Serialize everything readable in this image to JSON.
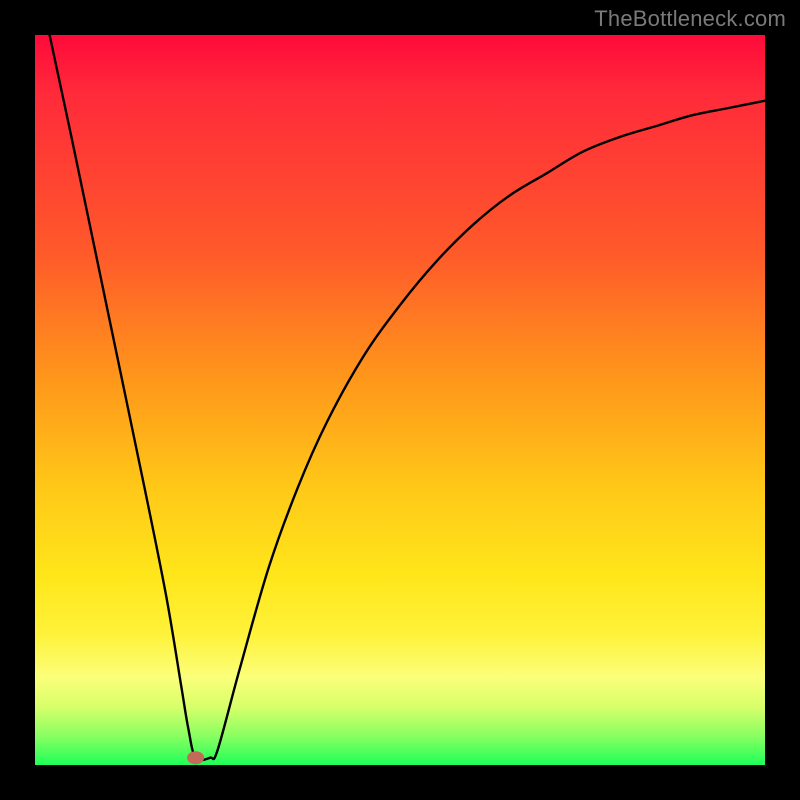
{
  "watermark": "TheBottleneck.com",
  "colors": {
    "gradient_top": "#ff0a3a",
    "gradient_mid1": "#ff9a1a",
    "gradient_mid2": "#ffe61a",
    "gradient_bottom": "#1eff58",
    "curve": "#000000",
    "dot": "#c46a5a",
    "frame": "#000000"
  },
  "chart_data": {
    "type": "line",
    "title": "",
    "xlabel": "",
    "ylabel": "",
    "xlim": [
      0,
      100
    ],
    "ylim": [
      0,
      100
    ],
    "series": [
      {
        "name": "bottleneck-curve",
        "x": [
          2,
          5,
          10,
          15,
          18,
          20,
          21,
          22,
          24,
          25,
          28,
          32,
          36,
          40,
          45,
          50,
          55,
          60,
          65,
          70,
          75,
          80,
          85,
          90,
          95,
          100
        ],
        "values": [
          100,
          86,
          62,
          38,
          23,
          11,
          5,
          1,
          1,
          2,
          13,
          27,
          38,
          47,
          56,
          63,
          69,
          74,
          78,
          81,
          84,
          86,
          87.5,
          89,
          90,
          91
        ]
      }
    ],
    "min_point": {
      "x": 22,
      "y": 1
    },
    "grid": false,
    "legend": false
  }
}
